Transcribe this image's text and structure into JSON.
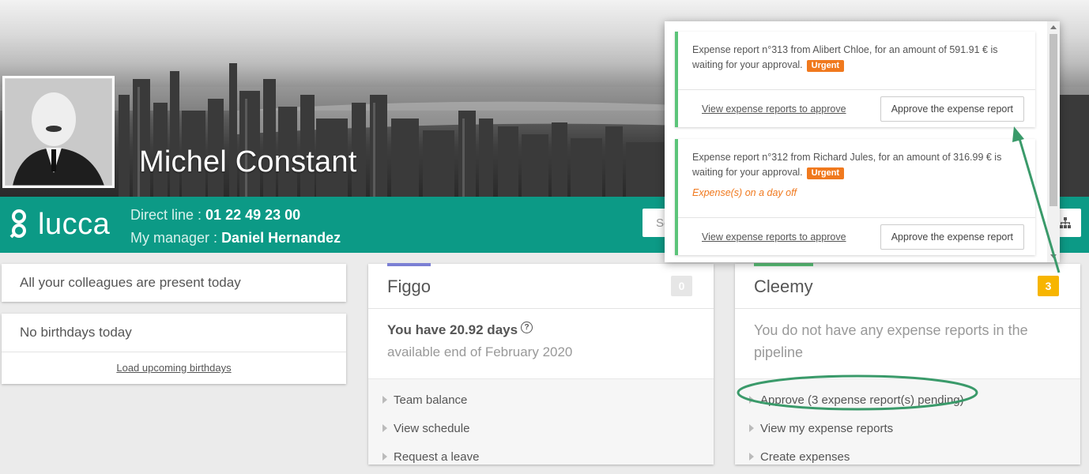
{
  "profile": {
    "name": "Michel Constant",
    "direct_line_label": "Direct line :",
    "direct_line_value": "01 22 49 23 00",
    "manager_label": "My manager :",
    "manager_value": "Daniel Hernandez"
  },
  "brand": {
    "logo_text": "lucca",
    "color_teal": "#0c9a86"
  },
  "search": {
    "placeholder_visible": "Se"
  },
  "widgets": {
    "colleagues": "All your colleagues are present today",
    "birthdays_title": "No birthdays today",
    "birthdays_link": "Load upcoming birthdays"
  },
  "figgo": {
    "name": "Figgo",
    "count": "0",
    "accent_color": "#7b7fd4",
    "days_text": "You have 20.92 days",
    "available_text": "available end of February 2020",
    "links": [
      "Team balance",
      "View schedule",
      "Request a leave"
    ]
  },
  "cleemy": {
    "name": "Cleemy",
    "count": "3",
    "accent_color": "#5cc47a",
    "empty_text": "You do not have any expense reports in the pipeline",
    "links": [
      "Approve (3 expense report(s) pending)",
      "View my expense reports",
      "Create expenses"
    ]
  },
  "notifications": [
    {
      "message": "Expense report n°313 from Alibert Chloe, for an amount of 591.91 € is waiting for your approval.",
      "badge": "Urgent",
      "warning": "",
      "view_link": "View expense reports to approve",
      "approve_label": "Approve the expense report"
    },
    {
      "message": "Expense report n°312 from Richard Jules, for an amount of 316.99 € is waiting for your approval.",
      "badge": "Urgent",
      "warning": "Expense(s) on a day off",
      "view_link": "View expense reports to approve",
      "approve_label": "Approve the expense report"
    }
  ],
  "colors": {
    "urgent": "#f0791e",
    "annotation_green": "#3a9a6a",
    "count_yellow": "#f7b500"
  }
}
